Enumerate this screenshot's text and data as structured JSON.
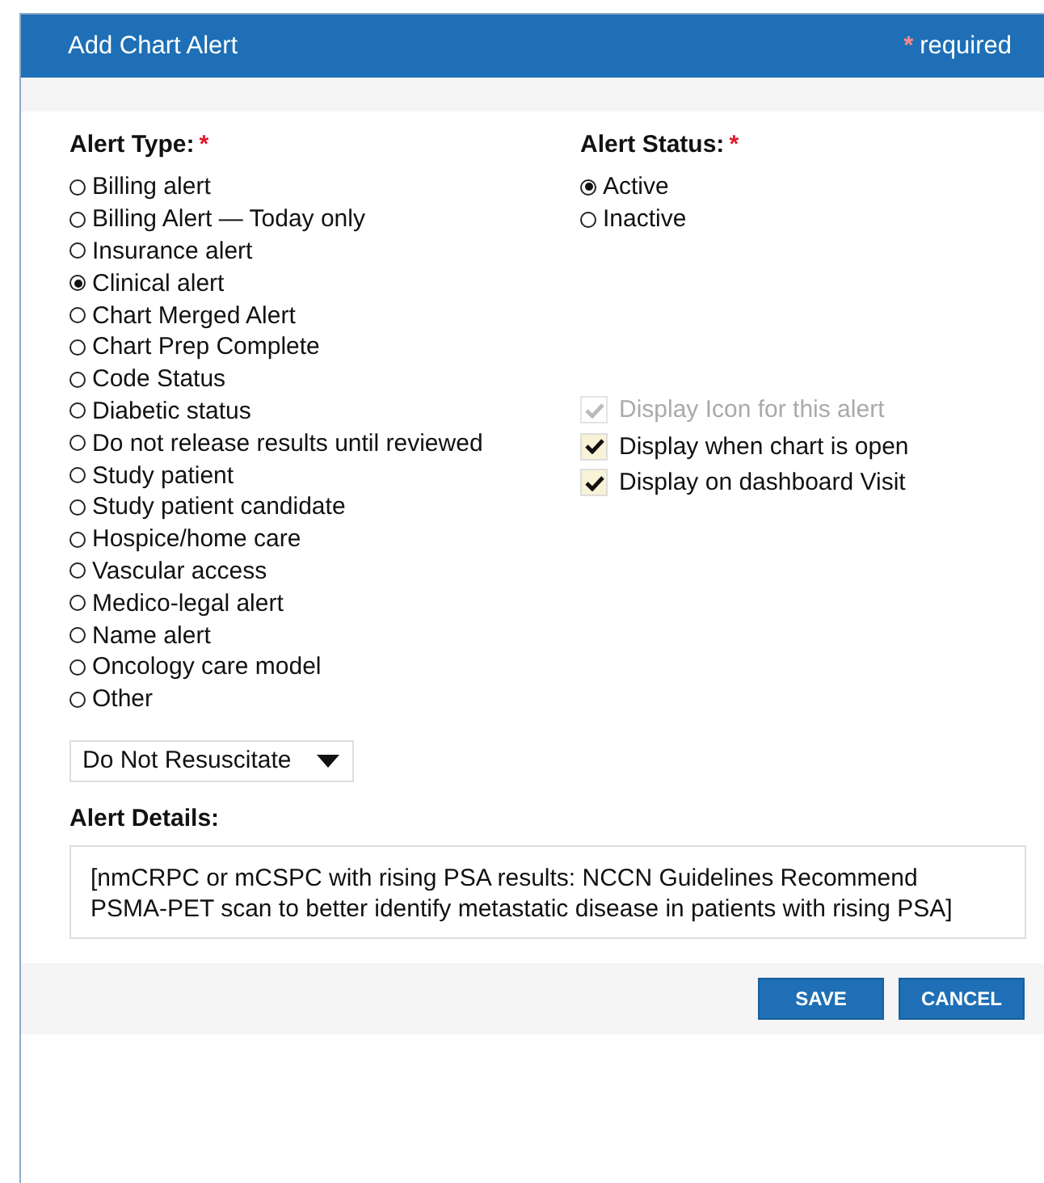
{
  "dialog": {
    "title": "Add Chart Alert",
    "required_note": {
      "mark": "*",
      "text": "required"
    }
  },
  "alert_type": {
    "label": "Alert Type:",
    "mark": "*",
    "options": [
      {
        "label": "Billing alert",
        "selected": false
      },
      {
        "label": "Billing Alert — Today only",
        "selected": false
      },
      {
        "label": "Insurance alert",
        "selected": false
      },
      {
        "label": "Clinical alert",
        "selected": true
      },
      {
        "label": "Chart Merged Alert",
        "selected": false
      },
      {
        "label": "Chart Prep Complete",
        "selected": false
      },
      {
        "label": "Code Status",
        "selected": false
      },
      {
        "label": "Diabetic status",
        "selected": false
      },
      {
        "label": "Do not release results until reviewed",
        "selected": false
      },
      {
        "label": "Study patient",
        "selected": false
      },
      {
        "label": "Study patient candidate",
        "selected": false
      },
      {
        "label": "Hospice/home care",
        "selected": false
      },
      {
        "label": "Vascular access",
        "selected": false
      },
      {
        "label": "Medico-legal alert",
        "selected": false
      },
      {
        "label": "Name alert",
        "selected": false
      },
      {
        "label": "Oncology care model",
        "selected": false
      },
      {
        "label": "Other",
        "selected": false
      }
    ]
  },
  "alert_status": {
    "label": "Alert Status:",
    "mark": "*",
    "options": [
      {
        "label": "Active",
        "selected": true
      },
      {
        "label": "Inactive",
        "selected": false
      }
    ]
  },
  "display_options": [
    {
      "label": "Display Icon for this alert",
      "checked": true,
      "disabled": true
    },
    {
      "label": "Display when chart is open",
      "checked": true,
      "disabled": false
    },
    {
      "label": "Display on dashboard Visit",
      "checked": true,
      "disabled": false
    }
  ],
  "code_status_dropdown": {
    "value": "Do Not Resuscitate"
  },
  "alert_details": {
    "label": "Alert Details:",
    "value": "[nmCRPC or mCSPC with rising PSA results: NCCN Guidelines Recommend PSMA-PET scan to better identify metastatic disease in patients with rising PSA]"
  },
  "buttons": [
    {
      "label": "SAVE"
    },
    {
      "label": "CANCEL"
    }
  ]
}
